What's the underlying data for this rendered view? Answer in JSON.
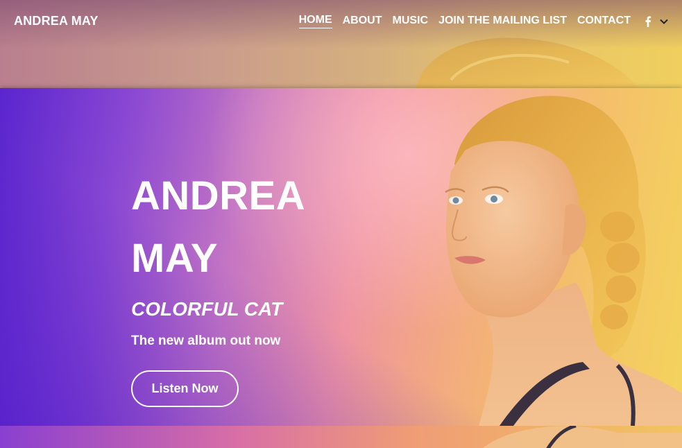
{
  "site": {
    "logo": "ANDREA MAY"
  },
  "nav": {
    "items": [
      {
        "label": "HOME",
        "active": true
      },
      {
        "label": "ABOUT",
        "active": false
      },
      {
        "label": "MUSIC",
        "active": false
      },
      {
        "label": "JOIN THE MAILING LIST",
        "active": false
      },
      {
        "label": "CONTACT",
        "active": false
      }
    ],
    "social_icon": "facebook-icon",
    "dropdown_icon": "chevron-down-icon"
  },
  "hero": {
    "title_line1": "ANDREA",
    "title_line2": "MAY",
    "album": "COLORFUL CAT",
    "tagline": "The new album out now",
    "cta_label": "Listen Now"
  },
  "colors": {
    "gradient_start": "#5a25cf",
    "gradient_mid": "#ee94a3",
    "gradient_end": "#f4d45c",
    "text": "#ffffff"
  }
}
